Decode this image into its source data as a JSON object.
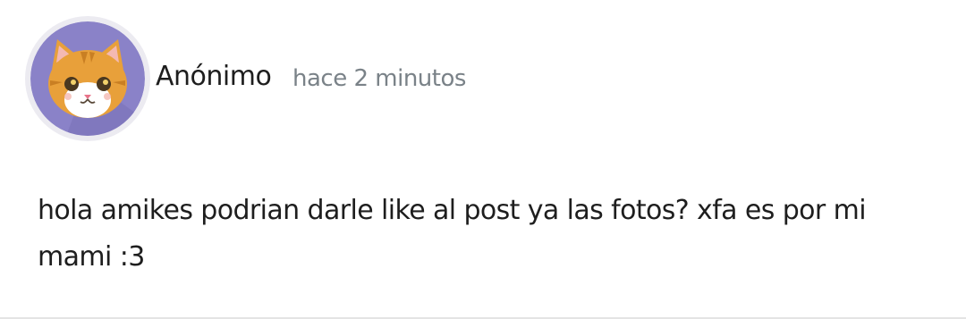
{
  "post": {
    "author": "Anónimo",
    "time": "hace 2 minutos",
    "message": "hola amikes podrian darle like al post ya las fotos? xfa es por mi mami :3",
    "avatar_icon": "cat-face-avatar"
  },
  "colors": {
    "avatar_bg": "#8a82c8",
    "avatar_ring": "#ecebf1",
    "cat_orange": "#e8a03a",
    "time_gray": "#7a8288"
  }
}
